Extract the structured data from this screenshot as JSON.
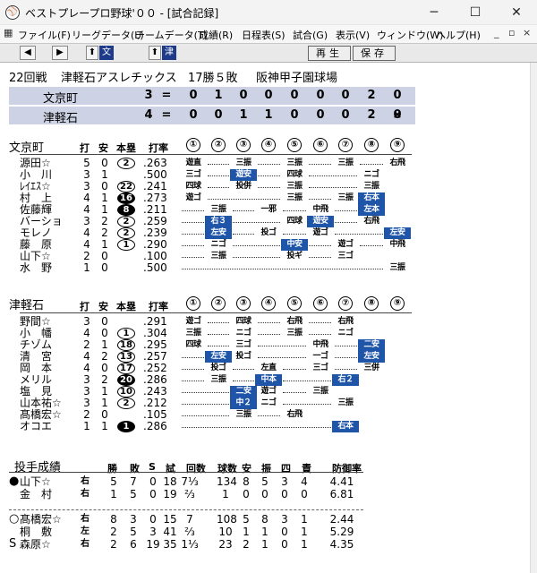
{
  "window": {
    "title": "ベストプレープロ野球'００ - [試合記録]",
    "minimize": "─",
    "maximize": "☐",
    "close": "✕"
  },
  "menu": [
    "ファイル(F)",
    "リーグデータ(L)",
    "チームデータ(T)",
    "成績(R)",
    "日程表(S)",
    "試合(G)",
    "表示(V)",
    "ウィンドウ(W)",
    "ヘルプ(H)"
  ],
  "mdi": {
    "minimize": "_",
    "restore": "▫",
    "close": "×"
  },
  "toolbar": {
    "prev": "◀",
    "next": "▶",
    "team_up": "⬆",
    "team_1": "文",
    "team_up2": "⬆",
    "team_2": "津",
    "replay": "再生",
    "save": "保存"
  },
  "game": {
    "round": "22回戦",
    "winner": "津軽石アスレチックス",
    "record": "17勝５敗",
    "stadium": "阪神甲子園球場"
  },
  "linescore": [
    {
      "team": "文京町",
      "runs": "3",
      "eq": "=",
      "innings": [
        "0",
        "1",
        "0",
        "0",
        "0",
        "0",
        "0",
        "2",
        "0"
      ]
    },
    {
      "team": "津軽石",
      "runs": "4",
      "eq": "=",
      "innings": [
        "0",
        "0",
        "1",
        "1",
        "0",
        "0",
        "0",
        "2",
        "0"
      ],
      "last": "×"
    }
  ],
  "headers": {
    "ab": "打",
    "hits": "安",
    "rbi": "本塁",
    "avg": "打率",
    "innings": [
      "①",
      "②",
      "③",
      "④",
      "⑤",
      "⑥",
      "⑦",
      "⑧",
      "⑨"
    ]
  },
  "away": {
    "name": "文京町",
    "batters": [
      {
        "name": "源田☆",
        "ab": "5",
        "h": "0",
        "rbi": "2",
        "avg": ".263",
        "inv": false,
        "res": [
          [
            "遊直",
            0,
            false
          ],
          [
            "三振",
            2,
            false
          ],
          [
            "三振",
            4,
            false
          ],
          [
            "三振",
            6,
            false
          ],
          [
            "右飛",
            8,
            false
          ]
        ]
      },
      {
        "name": "小　川",
        "ab": "3",
        "h": "1",
        "rbi": "",
        "avg": ".500",
        "inv": false,
        "res": [
          [
            "三ゴ",
            0,
            false
          ],
          [
            "遊安",
            2,
            true
          ],
          [
            "四球",
            4,
            false
          ],
          [
            "ニゴ",
            7,
            false
          ]
        ]
      },
      {
        "name": "ﾚｲｴｽ☆",
        "ab": "3",
        "h": "0",
        "rbi": "22",
        "avg": ".241",
        "inv": false,
        "res": [
          [
            "四球",
            0,
            false
          ],
          [
            "投併",
            2,
            false
          ],
          [
            "三振",
            4,
            false
          ],
          [
            "三振",
            7,
            false
          ]
        ]
      },
      {
        "name": "村　上",
        "ab": "4",
        "h": "1",
        "rbi": "16",
        "avg": ".273",
        "inv": true,
        "res": [
          [
            "遊ゴ",
            0,
            false
          ],
          [
            "三振",
            4,
            false
          ],
          [
            "三振",
            6,
            false
          ],
          [
            "右本",
            7,
            true
          ]
        ]
      },
      {
        "name": "佐藤輝",
        "ab": "4",
        "h": "1",
        "rbi": "8",
        "avg": ".211",
        "inv": true,
        "res": [
          [
            "三振",
            1,
            false
          ],
          [
            "一邪",
            3,
            false
          ],
          [
            "中飛",
            5,
            false
          ],
          [
            "左本",
            7,
            true
          ]
        ]
      },
      {
        "name": "バーショ",
        "ab": "3",
        "h": "2",
        "rbi": "2",
        "avg": ".259",
        "inv": false,
        "res": [
          [
            "右３",
            1,
            true
          ],
          [
            "四球",
            4,
            false
          ],
          [
            "遊安",
            5,
            true
          ],
          [
            "右飛",
            7,
            false
          ]
        ]
      },
      {
        "name": "モレノ",
        "ab": "4",
        "h": "2",
        "rbi": "2",
        "avg": ".239",
        "inv": false,
        "res": [
          [
            "左安",
            1,
            true
          ],
          [
            "投ゴ",
            3,
            false
          ],
          [
            "遊ゴ",
            5,
            false
          ],
          [
            "左安",
            8,
            true
          ]
        ]
      },
      {
        "name": "藤　原",
        "ab": "4",
        "h": "1",
        "rbi": "1",
        "avg": ".290",
        "inv": false,
        "res": [
          [
            "ニゴ",
            1,
            false
          ],
          [
            "中安",
            4,
            true
          ],
          [
            "遊ゴ",
            6,
            false
          ],
          [
            "中飛",
            8,
            false
          ]
        ]
      },
      {
        "name": "山下☆",
        "ab": "2",
        "h": "0",
        "rbi": "",
        "avg": ".100",
        "inv": false,
        "res": [
          [
            "三振",
            1,
            false
          ],
          [
            "投ギ",
            4,
            false
          ],
          [
            "三ゴ",
            6,
            false
          ]
        ]
      },
      {
        "name": "水　野",
        "ab": "1",
        "h": "0",
        "rbi": "",
        "avg": ".500",
        "inv": false,
        "res": [
          [
            "三振",
            8,
            false
          ]
        ]
      }
    ]
  },
  "home": {
    "name": "津軽石",
    "batters": [
      {
        "name": "野間☆",
        "ab": "3",
        "h": "0",
        "rbi": "",
        "avg": ".291",
        "inv": false,
        "res": [
          [
            "遊ゴ",
            0,
            false
          ],
          [
            "四球",
            2,
            false
          ],
          [
            "右飛",
            4,
            false
          ],
          [
            "右飛",
            6,
            false
          ]
        ]
      },
      {
        "name": "小　幡",
        "ab": "4",
        "h": "0",
        "rbi": "1",
        "avg": ".304",
        "inv": false,
        "res": [
          [
            "三振",
            0,
            false
          ],
          [
            "ニゴ",
            2,
            false
          ],
          [
            "三振",
            4,
            false
          ],
          [
            "ニゴ",
            6,
            false
          ]
        ]
      },
      {
        "name": "チゾム",
        "ab": "2",
        "h": "1",
        "rbi": "18",
        "avg": ".295",
        "inv": false,
        "res": [
          [
            "四球",
            0,
            false
          ],
          [
            "三ゴ",
            2,
            false
          ],
          [
            "中飛",
            5,
            false
          ],
          [
            "二安",
            7,
            true
          ]
        ]
      },
      {
        "name": "清　宮",
        "ab": "4",
        "h": "2",
        "rbi": "13",
        "avg": ".257",
        "inv": false,
        "res": [
          [
            "左安",
            1,
            true
          ],
          [
            "投ゴ",
            2,
            false
          ],
          [
            "一ゴ",
            5,
            false
          ],
          [
            "左安",
            7,
            true
          ]
        ]
      },
      {
        "name": "岡　本",
        "ab": "4",
        "h": "0",
        "rbi": "17",
        "avg": ".252",
        "inv": false,
        "res": [
          [
            "投ゴ",
            1,
            false
          ],
          [
            "左直",
            3,
            false
          ],
          [
            "三ゴ",
            5,
            false
          ],
          [
            "三併",
            7,
            false
          ]
        ]
      },
      {
        "name": "メリル",
        "ab": "3",
        "h": "2",
        "rbi": "20",
        "avg": ".286",
        "inv": true,
        "res": [
          [
            "三振",
            1,
            false
          ],
          [
            "中本",
            3,
            true
          ],
          [
            "右２",
            6,
            true
          ]
        ]
      },
      {
        "name": "塩　見",
        "ab": "3",
        "h": "1",
        "rbi": "10",
        "avg": ".243",
        "inv": false,
        "res": [
          [
            "二安",
            2,
            true
          ],
          [
            "遊ゴ",
            3,
            false
          ],
          [
            "三振",
            5,
            false
          ]
        ]
      },
      {
        "name": "山本祐☆",
        "ab": "3",
        "h": "1",
        "rbi": "2",
        "avg": ".212",
        "inv": false,
        "res": [
          [
            "中２",
            2,
            true
          ],
          [
            "ニゴ",
            3,
            false
          ],
          [
            "三振",
            6,
            false
          ]
        ]
      },
      {
        "name": "髙橋宏☆",
        "ab": "2",
        "h": "0",
        "rbi": "",
        "avg": ".105",
        "inv": false,
        "res": [
          [
            "三振",
            2,
            false
          ],
          [
            "右飛",
            4,
            false
          ]
        ]
      },
      {
        "name": "オコエ",
        "ab": "1",
        "h": "1",
        "rbi": "1",
        "avg": ".286",
        "inv": true,
        "res": [
          [
            "右本",
            6,
            true
          ]
        ]
      }
    ]
  },
  "pitching": {
    "title": "投手成績",
    "headers": [
      "勝",
      "敗",
      "S",
      "試",
      "回数",
      "球数",
      "安",
      "振",
      "四",
      "責",
      "防御率"
    ],
    "away": [
      {
        "mark": "●",
        "name": "山下☆",
        "hand": "右",
        "w": "5",
        "l": "7",
        "s": "0",
        "g": "18",
        "ip": "7⅓",
        "np": "134",
        "h": "8",
        "k": "5",
        "bb": "3",
        "er": "4",
        "era": "4.41"
      },
      {
        "mark": "",
        "name": "金　村",
        "hand": "右",
        "w": "1",
        "l": "5",
        "s": "0",
        "g": "19",
        "ip": "⅔",
        "np": "1",
        "h": "0",
        "k": "0",
        "bb": "0",
        "er": "0",
        "era": "6.81"
      }
    ],
    "home": [
      {
        "mark": "○",
        "name": "髙橋宏☆",
        "hand": "右",
        "w": "8",
        "l": "3",
        "s": "0",
        "g": "15",
        "ip": "7",
        "np": "108",
        "h": "5",
        "k": "8",
        "bb": "3",
        "er": "1",
        "era": "2.44"
      },
      {
        "mark": "",
        "name": "桐　敷",
        "hand": "左",
        "w": "2",
        "l": "5",
        "s": "3",
        "g": "41",
        "ip": "⅔",
        "np": "10",
        "h": "1",
        "k": "1",
        "bb": "0",
        "er": "1",
        "era": "5.29"
      },
      {
        "mark": "S",
        "name": "森原☆",
        "hand": "右",
        "w": "2",
        "l": "6",
        "s": "19",
        "g": "35",
        "ip": "1⅓",
        "np": "23",
        "h": "2",
        "k": "1",
        "bb": "0",
        "er": "1",
        "era": "4.35"
      }
    ]
  }
}
